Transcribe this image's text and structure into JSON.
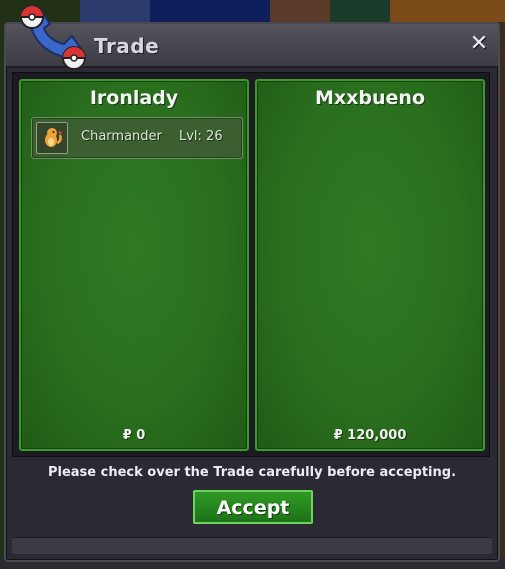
{
  "window": {
    "title": "Trade",
    "close_symbol": "✕"
  },
  "traders": [
    {
      "name": "Ironlady",
      "items": [
        {
          "icon": "charmander-icon",
          "name": "Charmander",
          "level": "Lvl: 26"
        }
      ],
      "money": "₽ 0"
    },
    {
      "name": "Mxxbueno",
      "items": [],
      "money": "₽ 120,000"
    }
  ],
  "notice": "Please check over the Trade carefully before accepting.",
  "accept_label": "Accept",
  "colors": {
    "panel_green": "#2a6f1e",
    "panel_border": "#3c9a2d",
    "window": "#2b2a33",
    "button": "#2f9a25"
  }
}
